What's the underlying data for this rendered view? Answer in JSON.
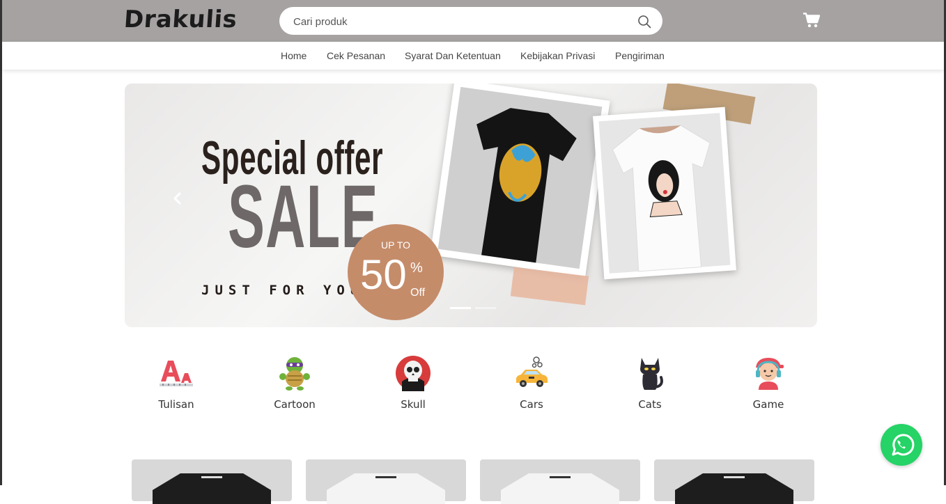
{
  "brand": {
    "logo": "Drakulis"
  },
  "search": {
    "placeholder": "Cari produk"
  },
  "nav": [
    {
      "label": "Home"
    },
    {
      "label": "Cek Pesanan"
    },
    {
      "label": "Syarat Dan Ketentuan"
    },
    {
      "label": "Kebijakan Privasi"
    },
    {
      "label": "Pengiriman"
    }
  ],
  "banner": {
    "headline": "Special offer",
    "sale": "SALE",
    "badge_upto": "UP TO",
    "badge_percent": "50",
    "badge_percent_sign": "%",
    "badge_off": "Off",
    "tagline": "JUST FOR YOU",
    "slides": 2,
    "active_slide": 1
  },
  "categories": [
    {
      "label": "Tulisan",
      "icon": "letters-icon"
    },
    {
      "label": "Cartoon",
      "icon": "turtle-icon"
    },
    {
      "label": "Skull",
      "icon": "skull-icon"
    },
    {
      "label": "Cars",
      "icon": "car-icon"
    },
    {
      "label": "Cats",
      "icon": "cat-icon"
    },
    {
      "label": "Game",
      "icon": "gamer-icon"
    }
  ],
  "colors": {
    "topbar": "#a5a2a1",
    "badge": "#c58c6a",
    "whatsapp": "#25d366"
  }
}
